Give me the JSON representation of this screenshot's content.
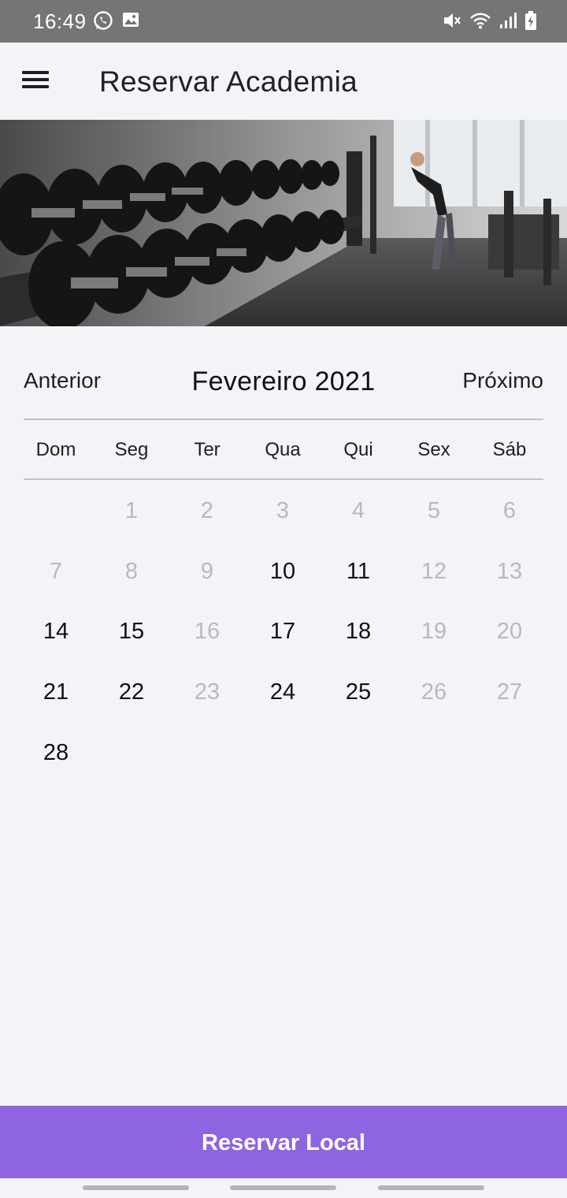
{
  "status_bar": {
    "time": "16:49",
    "left_icons": [
      "whatsapp-icon",
      "gallery-icon"
    ],
    "right_icons": [
      "mute-icon",
      "wifi-icon",
      "signal-icon",
      "battery-icon"
    ]
  },
  "app_bar": {
    "menu_icon": "hamburger-menu-icon",
    "title": "Reservar Academia"
  },
  "banner": {
    "image": "gym-dumbbells-photo"
  },
  "calendar": {
    "prev_label": "Anterior",
    "month_label": "Fevereiro 2021",
    "next_label": "Próximo",
    "weekdays": [
      "Dom",
      "Seg",
      "Ter",
      "Qua",
      "Qui",
      "Sex",
      "Sáb"
    ],
    "first_weekday_offset": 1,
    "days": [
      {
        "label": "1",
        "enabled": false
      },
      {
        "label": "2",
        "enabled": false
      },
      {
        "label": "3",
        "enabled": false
      },
      {
        "label": "4",
        "enabled": false
      },
      {
        "label": "5",
        "enabled": false
      },
      {
        "label": "6",
        "enabled": false
      },
      {
        "label": "7",
        "enabled": false
      },
      {
        "label": "8",
        "enabled": false
      },
      {
        "label": "9",
        "enabled": false
      },
      {
        "label": "10",
        "enabled": true
      },
      {
        "label": "11",
        "enabled": true
      },
      {
        "label": "12",
        "enabled": false
      },
      {
        "label": "13",
        "enabled": false
      },
      {
        "label": "14",
        "enabled": true
      },
      {
        "label": "15",
        "enabled": true
      },
      {
        "label": "16",
        "enabled": false
      },
      {
        "label": "17",
        "enabled": true
      },
      {
        "label": "18",
        "enabled": true
      },
      {
        "label": "19",
        "enabled": false
      },
      {
        "label": "20",
        "enabled": false
      },
      {
        "label": "21",
        "enabled": true
      },
      {
        "label": "22",
        "enabled": true
      },
      {
        "label": "23",
        "enabled": false
      },
      {
        "label": "24",
        "enabled": true
      },
      {
        "label": "25",
        "enabled": true
      },
      {
        "label": "26",
        "enabled": false
      },
      {
        "label": "27",
        "enabled": false
      },
      {
        "label": "28",
        "enabled": true
      }
    ]
  },
  "footer": {
    "reserve_button_label": "Reservar Local"
  },
  "colors": {
    "accent": "#8e65e0",
    "status_bar": "#757575",
    "background": "#f3f4f8",
    "day_enabled": "#111111",
    "day_disabled": "#b9b9bd"
  }
}
